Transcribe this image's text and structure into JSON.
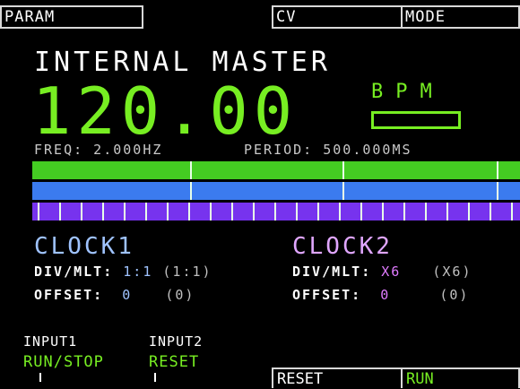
{
  "tabs": {
    "param": "PARAM",
    "cv": "CV",
    "mode": "MODE"
  },
  "title": "INTERNAL MASTER",
  "tempo": {
    "value": "120.00",
    "unit": "BPM"
  },
  "freq": "FREQ: 2.000HZ",
  "period": "PERIOD: 500.000MS",
  "clock1": {
    "title": "CLOCK1",
    "div_label": "DIV/MLT:",
    "div_value": "1:1",
    "div_cv": "(1:1)",
    "offset_label": "OFFSET:",
    "offset_value": "0",
    "offset_cv": "(0)"
  },
  "clock2": {
    "title": "CLOCK2",
    "div_label": "DIV/MLT:",
    "div_value": "X6",
    "div_cv": "(X6)",
    "offset_label": "OFFSET:",
    "offset_value": "0",
    "offset_cv": "(0)"
  },
  "inputs": [
    {
      "label": "INPUT1",
      "value": "RUN/STOP"
    },
    {
      "label": "INPUT2",
      "value": "RESET"
    }
  ],
  "buttons": {
    "reset": "RESET",
    "run": "RUN"
  },
  "colors": {
    "accent": "#77ee22",
    "clock1": "#9fc3ff",
    "clock2": "#e07bff",
    "bar_green": "#44cc22",
    "bar_blue": "#3b7bef",
    "bar_purple": "#7733ee"
  }
}
